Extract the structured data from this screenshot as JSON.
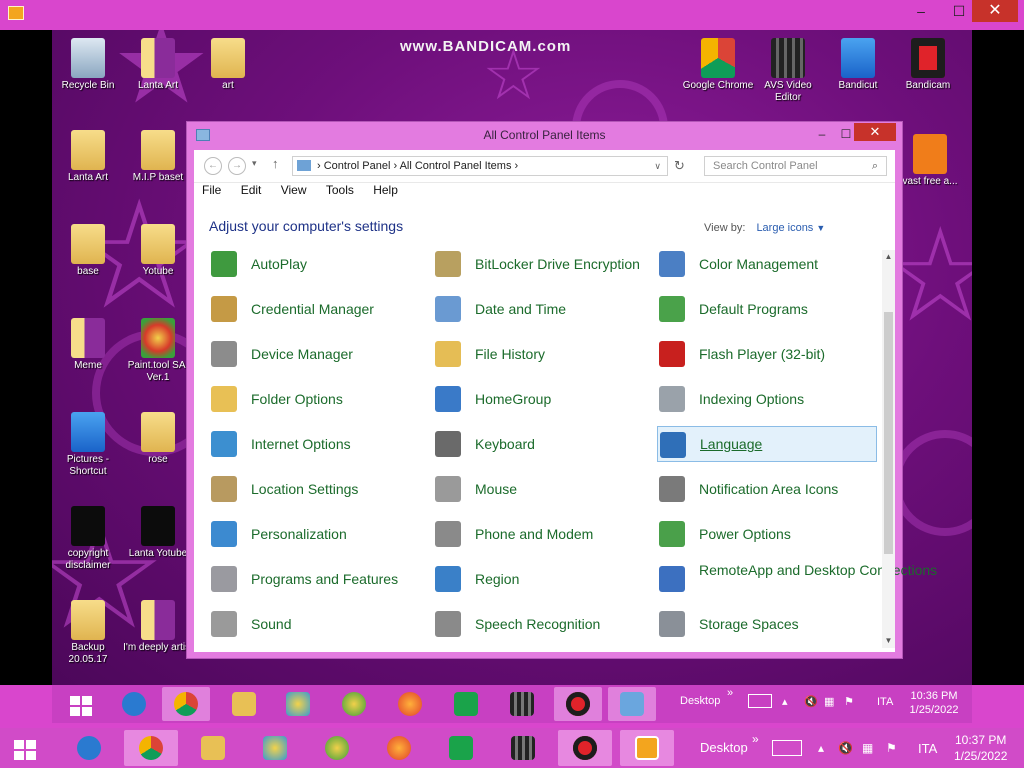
{
  "watermark": "www.BANDICAM.com",
  "desktop_icons": [
    {
      "label": "Recycle Bin"
    },
    {
      "label": "Lanta Art"
    },
    {
      "label": "art"
    },
    {
      "label": "Lanta Art"
    },
    {
      "label": "M.I.P baset"
    },
    {
      "label": "base"
    },
    {
      "label": "Yotube"
    },
    {
      "label": "Meme"
    },
    {
      "label": "Paint.tool SAI Ver.1"
    },
    {
      "label": "Pictures - Shortcut"
    },
    {
      "label": "rose"
    },
    {
      "label": "copyright disclaimer"
    },
    {
      "label": "Lanta Yotube"
    },
    {
      "label": "Backup 20.05.17"
    },
    {
      "label": "I'm deeply artist"
    },
    {
      "label": "Google Chrome"
    },
    {
      "label": "AVS Video Editor"
    },
    {
      "label": "Bandicut"
    },
    {
      "label": "Bandicam"
    },
    {
      "label": "vast free a..."
    }
  ],
  "window": {
    "title": "All Control Panel Items",
    "breadcrumb": [
      "Control Panel",
      "All Control Panel Items"
    ],
    "search_placeholder": "Search Control Panel",
    "menu": [
      "File",
      "Edit",
      "View",
      "Tools",
      "Help"
    ],
    "heading": "Adjust your computer's settings",
    "view_by_label": "View by:",
    "view_by_value": "Large icons",
    "items": [
      {
        "label": "AutoPlay",
        "icon": "autoplay-icon",
        "color": "#3f9a3f"
      },
      {
        "label": "BitLocker Drive Encryption",
        "icon": "bitlocker-icon",
        "color": "#b8a060"
      },
      {
        "label": "Color Management",
        "icon": "color-management-icon",
        "color": "#4b7fc4"
      },
      {
        "label": "Credential Manager",
        "icon": "credential-manager-icon",
        "color": "#c59a45"
      },
      {
        "label": "Date and Time",
        "icon": "date-time-icon",
        "color": "#6a9ad2"
      },
      {
        "label": "Default Programs",
        "icon": "default-programs-icon",
        "color": "#4aa24a"
      },
      {
        "label": "Device Manager",
        "icon": "device-manager-icon",
        "color": "#8c8c8c"
      },
      {
        "label": "File History",
        "icon": "file-history-icon",
        "color": "#e5bd55"
      },
      {
        "label": "Flash Player (32-bit)",
        "icon": "flash-player-icon",
        "color": "#c8201e"
      },
      {
        "label": "Folder Options",
        "icon": "folder-options-icon",
        "color": "#e8c055"
      },
      {
        "label": "HomeGroup",
        "icon": "homegroup-icon",
        "color": "#3a7ac8"
      },
      {
        "label": "Indexing Options",
        "icon": "indexing-options-icon",
        "color": "#9aa2aa"
      },
      {
        "label": "Internet Options",
        "icon": "internet-options-icon",
        "color": "#3c8fd0"
      },
      {
        "label": "Keyboard",
        "icon": "keyboard-icon",
        "color": "#6a6a6a"
      },
      {
        "label": "Language",
        "icon": "language-icon",
        "color": "#2f6fb8"
      },
      {
        "label": "Location Settings",
        "icon": "location-settings-icon",
        "color": "#b89a60"
      },
      {
        "label": "Mouse",
        "icon": "mouse-icon",
        "color": "#9a9a9a"
      },
      {
        "label": "Notification Area Icons",
        "icon": "notification-area-icon",
        "color": "#7a7a7a"
      },
      {
        "label": "Personalization",
        "icon": "personalization-icon",
        "color": "#3c8ad0"
      },
      {
        "label": "Phone and Modem",
        "icon": "phone-modem-icon",
        "color": "#8a8a8a"
      },
      {
        "label": "Power Options",
        "icon": "power-options-icon",
        "color": "#4aa04a"
      },
      {
        "label": "Programs and Features",
        "icon": "programs-features-icon",
        "color": "#9a9aa0"
      },
      {
        "label": "Region",
        "icon": "region-icon",
        "color": "#3a80c8"
      },
      {
        "label": "RemoteApp and Desktop Connections",
        "icon": "remoteapp-icon",
        "color": "#3c70c0"
      },
      {
        "label": "Sound",
        "icon": "sound-icon",
        "color": "#9a9a9a"
      },
      {
        "label": "Speech Recognition",
        "icon": "speech-recognition-icon",
        "color": "#8a8a8a"
      },
      {
        "label": "Storage Spaces",
        "icon": "storage-spaces-icon",
        "color": "#8a9098"
      }
    ]
  },
  "inner_taskbar": {
    "desktop_label": "Desktop",
    "language": "ITA",
    "time": "10:36 PM",
    "date": "1/25/2022"
  },
  "outer_taskbar": {
    "desktop_label": "Desktop",
    "language": "ITA",
    "time": "10:37 PM",
    "date": "1/25/2022"
  }
}
